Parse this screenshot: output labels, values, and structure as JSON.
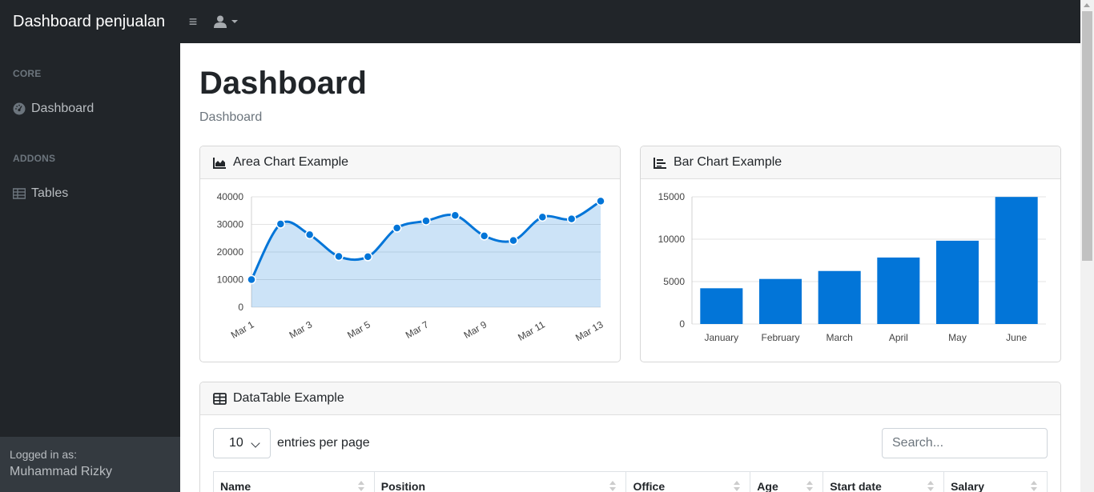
{
  "navbar": {
    "brand": "Dashboard penjualan",
    "toggle_icon": "bars-icon",
    "user_icon": "user-icon"
  },
  "sidebar": {
    "sections": [
      {
        "heading": "CORE",
        "items": [
          {
            "label": "Dashboard",
            "icon": "tachometer-icon"
          }
        ]
      },
      {
        "heading": "ADDONS",
        "items": [
          {
            "label": "Tables",
            "icon": "table-icon"
          }
        ]
      }
    ],
    "footer": {
      "small": "Logged in as:",
      "name": "Muhammad Rizky"
    }
  },
  "main": {
    "title": "Dashboard",
    "breadcrumb": "Dashboard"
  },
  "area_card": {
    "title": "Area Chart Example",
    "icon": "chart-area-icon"
  },
  "bar_card": {
    "title": "Bar Chart Example",
    "icon": "chart-bar-icon"
  },
  "table_card": {
    "title": "DataTable Example",
    "icon": "table-icon",
    "per_page_value": "10",
    "per_page_label": "entries per page",
    "search_placeholder": "Search...",
    "columns": [
      "Name",
      "Position",
      "Office",
      "Age",
      "Start date",
      "Salary"
    ]
  },
  "colors": {
    "accent": "#0275d8",
    "area_fill": "rgba(2,117,216,0.2)",
    "sidebar_bg": "#212529"
  },
  "chart_data": [
    {
      "type": "area",
      "categories": [
        "Mar 1",
        "Mar 2",
        "Mar 3",
        "Mar 4",
        "Mar 5",
        "Mar 6",
        "Mar 7",
        "Mar 8",
        "Mar 9",
        "Mar 10",
        "Mar 11",
        "Mar 12",
        "Mar 13"
      ],
      "x_tick_labels": [
        "Mar 1",
        "Mar 3",
        "Mar 5",
        "Mar 7",
        "Mar 9",
        "Mar 11",
        "Mar 13"
      ],
      "values": [
        10000,
        30162,
        26263,
        18394,
        18287,
        28682,
        31274,
        33259,
        25849,
        24159,
        32651,
        31984,
        38451
      ],
      "ylim": [
        0,
        40000
      ],
      "y_ticks": [
        0,
        10000,
        20000,
        30000,
        40000
      ],
      "grid": true,
      "color": "#0275d8"
    },
    {
      "type": "bar",
      "categories": [
        "January",
        "February",
        "March",
        "April",
        "May",
        "June"
      ],
      "values": [
        4215,
        5312,
        6251,
        7841,
        9821,
        14984
      ],
      "ylim": [
        0,
        15000
      ],
      "y_ticks": [
        0,
        5000,
        10000,
        15000
      ],
      "grid": true,
      "color": "#0275d8"
    }
  ]
}
